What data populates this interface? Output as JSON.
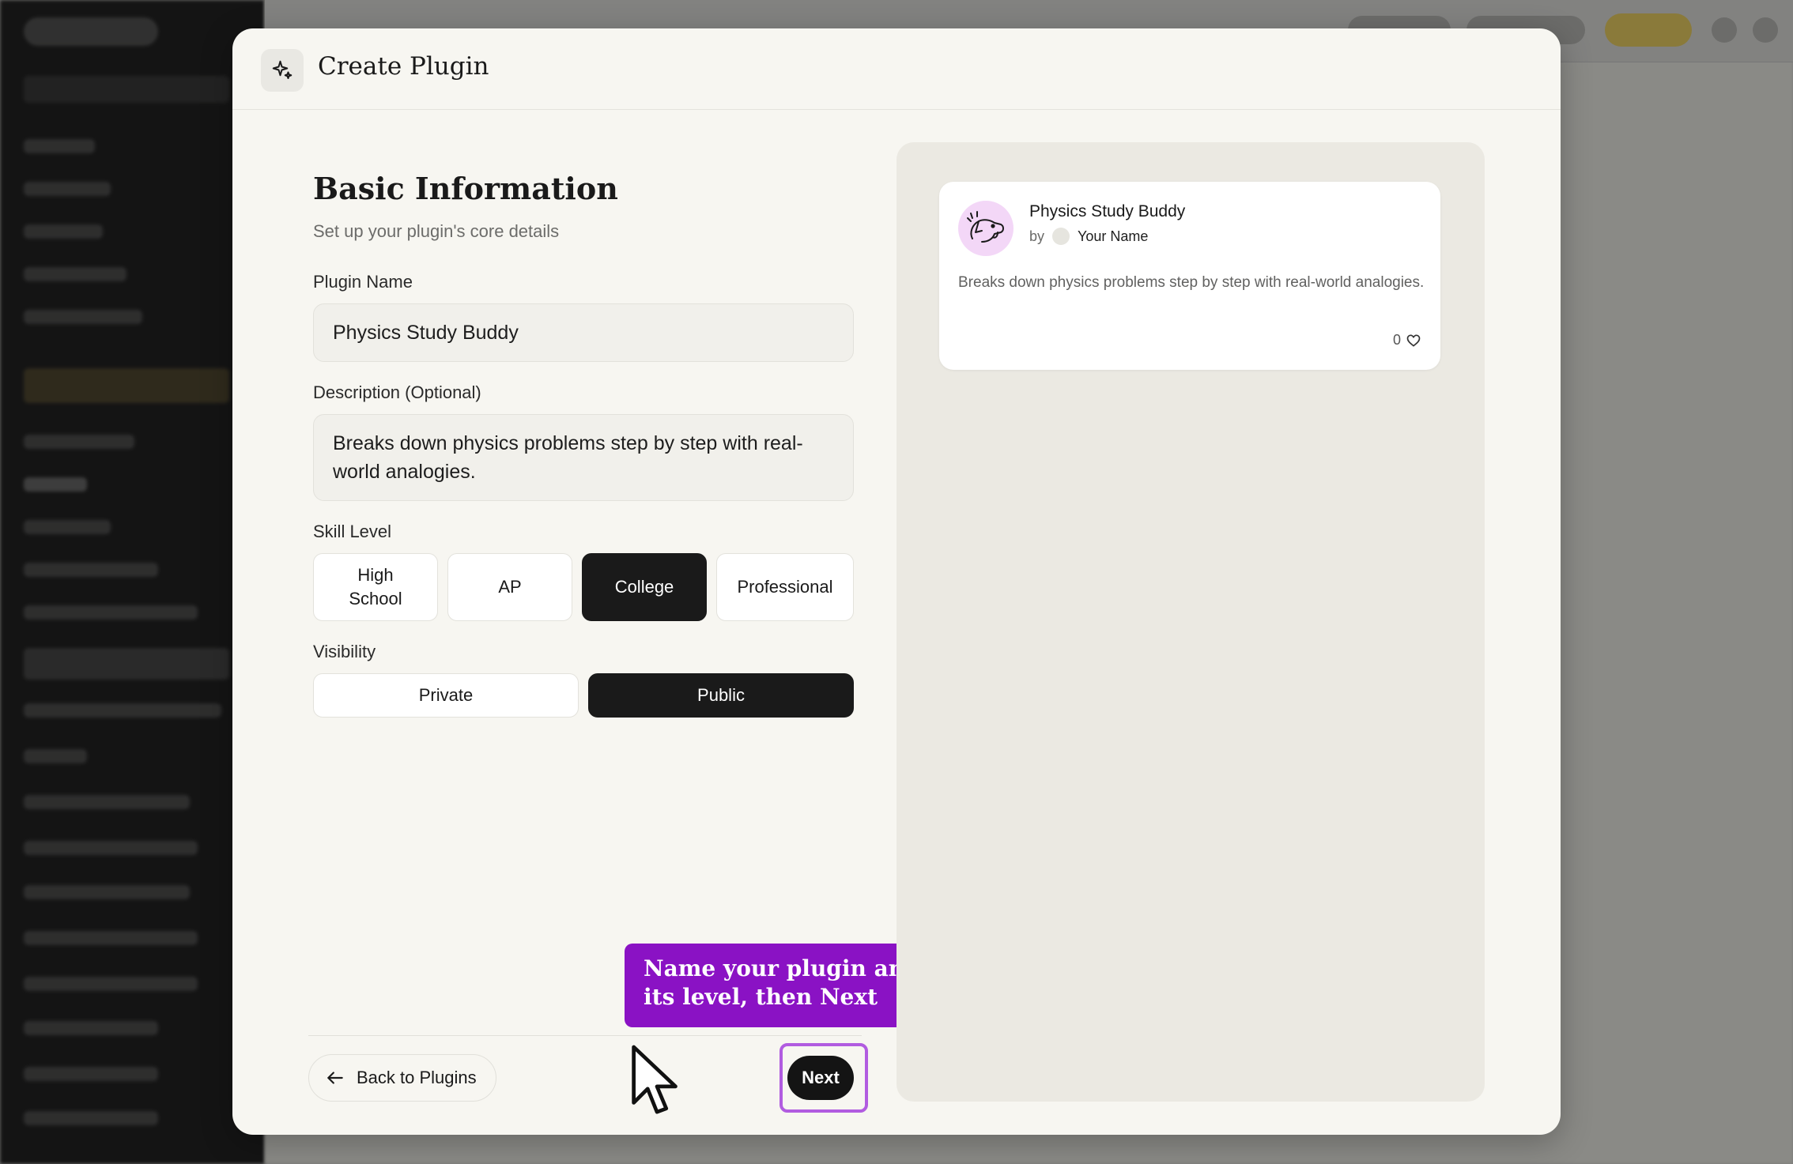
{
  "modal": {
    "title": "Create Plugin",
    "icon": "sparkle-icon"
  },
  "form": {
    "section_title": "Basic Information",
    "section_subtitle": "Set up your plugin's core details",
    "name_label": "Plugin Name",
    "name_value": "Physics Study Buddy",
    "description_label": "Description (Optional)",
    "description_value": "Breaks down physics problems step by step with real-world analogies.",
    "skill_label": "Skill Level",
    "skill_options": [
      "High School",
      "AP",
      "College",
      "Professional"
    ],
    "skill_selected": "College",
    "visibility_label": "Visibility",
    "visibility_options": [
      "Private",
      "Public"
    ],
    "visibility_selected": "Public"
  },
  "footer": {
    "back_label": "Back to Plugins",
    "next_label": "Next"
  },
  "tooltip": {
    "text": "Name your plugin and set its level, then Next"
  },
  "preview": {
    "name": "Physics Study Buddy",
    "by_prefix": "by",
    "author": "Your Name",
    "description": "Breaks down physics problems step by step with real-world analogies.",
    "likes": "0"
  },
  "colors": {
    "accent_purple": "#8a12c4",
    "highlight_border": "#b15ce0",
    "primary_dark": "#141414",
    "modal_bg": "#f7f6f1"
  }
}
